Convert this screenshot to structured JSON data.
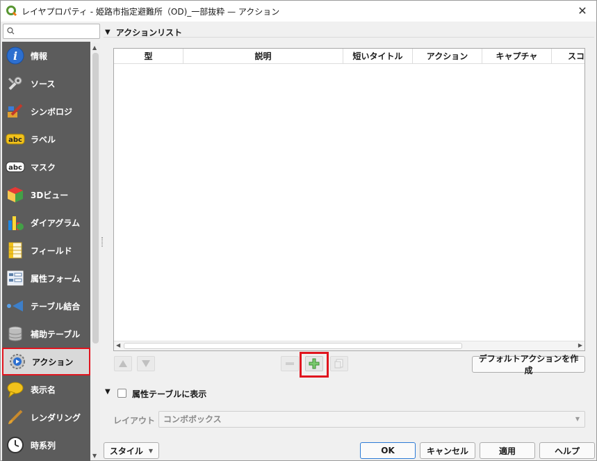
{
  "window": {
    "title": "レイヤプロパティ - 姫路市指定避難所（OD)_一部抜粋 — アクション",
    "close_glyph": "✕"
  },
  "search": {
    "placeholder": "",
    "value": ""
  },
  "sidebar": {
    "items": [
      {
        "label": "情報",
        "icon": "info-icon"
      },
      {
        "label": "ソース",
        "icon": "wrench-icon"
      },
      {
        "label": "シンボロジ",
        "icon": "brush-icon"
      },
      {
        "label": "ラベル",
        "icon": "label-abc-icon"
      },
      {
        "label": "マスク",
        "icon": "mask-abc-icon"
      },
      {
        "label": "3Dビュー",
        "icon": "cube-3d-icon"
      },
      {
        "label": "ダイアグラム",
        "icon": "diagram-icon"
      },
      {
        "label": "フィールド",
        "icon": "fields-icon"
      },
      {
        "label": "属性フォーム",
        "icon": "form-icon"
      },
      {
        "label": "テーブル結合",
        "icon": "join-icon"
      },
      {
        "label": "補助テーブル",
        "icon": "database-icon"
      },
      {
        "label": "アクション",
        "icon": "action-gear-icon",
        "selected": true
      },
      {
        "label": "表示名",
        "icon": "speech-bubble-icon"
      },
      {
        "label": "レンダリング",
        "icon": "paint-brush-icon"
      },
      {
        "label": "時系列",
        "icon": "clock-icon"
      }
    ]
  },
  "actions_section": {
    "title": "アクションリスト",
    "columns": [
      "型",
      "説明",
      "短いタイトル",
      "アクション",
      "キャプチャ",
      "スコ"
    ],
    "rows": [],
    "default_actions_button": "デフォルトアクションを作成"
  },
  "attr_section": {
    "checkbox_label": "属性テーブルに表示",
    "checked": false,
    "layout_label": "レイアウト",
    "layout_value": "コンボボックス"
  },
  "footer": {
    "style_label": "スタイル",
    "ok_label": "OK",
    "cancel_label": "キャンセル",
    "apply_label": "適用",
    "help_label": "ヘルプ"
  },
  "colors": {
    "sidebar_bg": "#5c5c5c",
    "highlight": "#e0141e",
    "accent": "#2b7ad6"
  }
}
